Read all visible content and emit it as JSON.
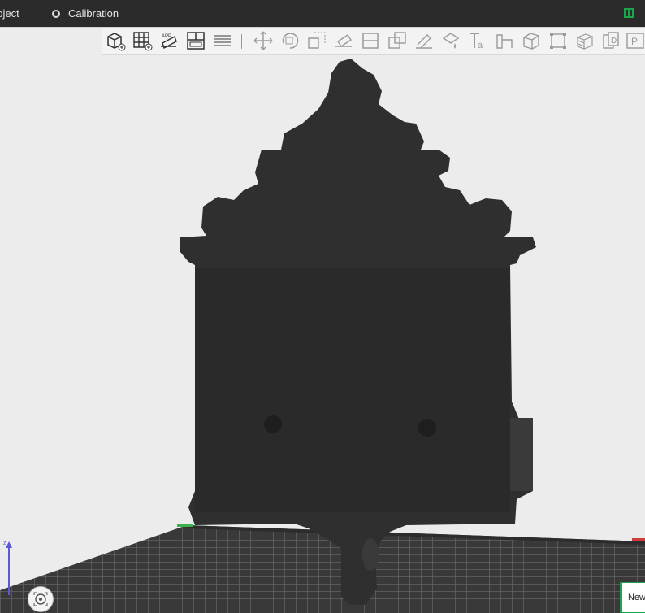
{
  "tabs": {
    "project": "roject",
    "calibration": "Calibration"
  },
  "toolbar": {
    "icons": [
      "add-object-icon",
      "grid-icon",
      "auto-arrange-icon",
      "layout-icon",
      "layers-icon",
      "move-icon",
      "rotate-icon",
      "scale-icon",
      "place-on-face-icon",
      "cut-icon",
      "boolean-icon",
      "support-paint-icon",
      "seam-paint-icon",
      "text-icon",
      "measure-icon",
      "assemble-icon",
      "split-icon",
      "stack-icon",
      "variable-layer-icon",
      "plate-icon"
    ]
  },
  "new_button_label": "New",
  "accent_color": "#1ea44b"
}
